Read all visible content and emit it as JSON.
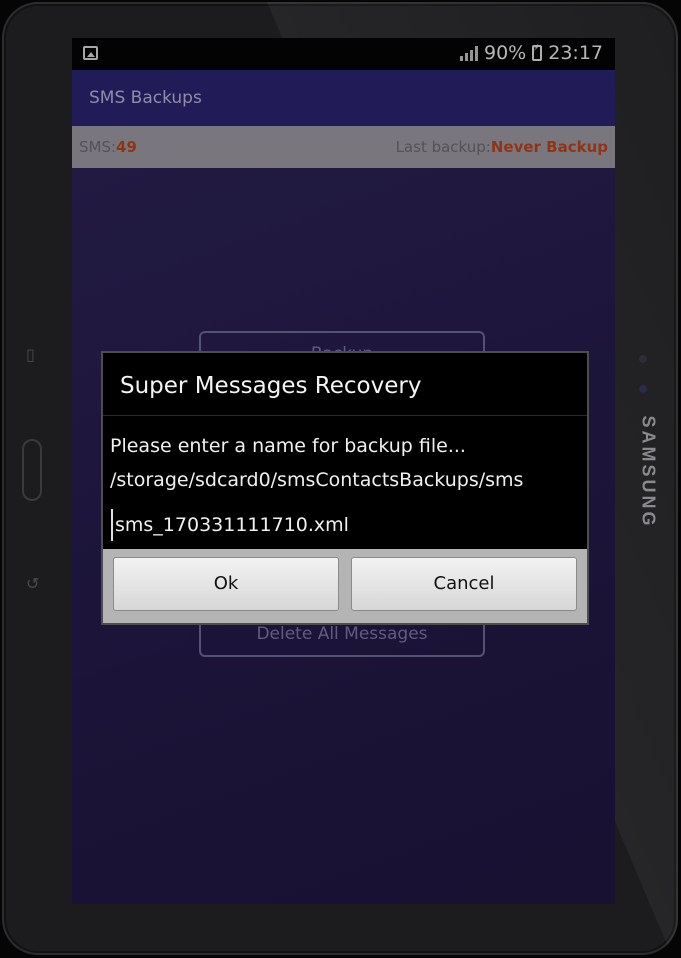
{
  "device": {
    "brand": "SAMSUNG"
  },
  "status_bar": {
    "battery": "90%",
    "time": "23:17"
  },
  "app": {
    "title": "SMS Backups"
  },
  "info": {
    "sms_label": "SMS:",
    "sms_count": "49",
    "last_backup_label": "Last backup:",
    "last_backup_value": "Never Backup"
  },
  "background_buttons": {
    "backup": "Backup",
    "delete_all": "Delete All Messages"
  },
  "dialog": {
    "title": "Super Messages Recovery",
    "message_line1": "Please enter a name for backup file...",
    "message_line2": "/storage/sdcard0/smsContactsBackups/sms",
    "filename_value": "sms_170331111710.xml",
    "ok_label": "Ok",
    "cancel_label": "Cancel"
  }
}
